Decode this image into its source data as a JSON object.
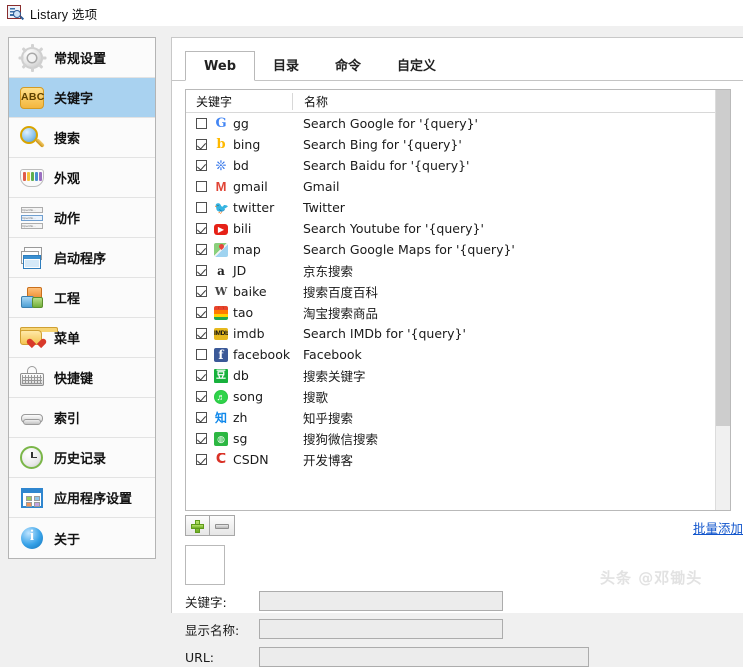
{
  "window": {
    "title": "Listary 选项",
    "icon": "listary-app-icon"
  },
  "sidebar": {
    "items": [
      {
        "label": "常规设置",
        "icon": "gear-icon",
        "selected": false
      },
      {
        "label": "关键字",
        "icon": "abc-icon",
        "selected": true
      },
      {
        "label": "搜索",
        "icon": "magnifier-icon",
        "selected": false
      },
      {
        "label": "外观",
        "icon": "color-fan-icon",
        "selected": false
      },
      {
        "label": "动作",
        "icon": "actions-list-icon",
        "selected": false
      },
      {
        "label": "启动程序",
        "icon": "windows-stack-icon",
        "selected": false
      },
      {
        "label": "工程",
        "icon": "boxes-icon",
        "selected": false
      },
      {
        "label": "菜单",
        "icon": "folder-heart-icon",
        "selected": false
      },
      {
        "label": "快捷键",
        "icon": "keyboard-icon",
        "selected": false
      },
      {
        "label": "索引",
        "icon": "drive-icon",
        "selected": false
      },
      {
        "label": "历史记录",
        "icon": "clock-history-icon",
        "selected": false
      },
      {
        "label": "应用程序设置",
        "icon": "app-settings-icon",
        "selected": false
      },
      {
        "label": "关于",
        "icon": "info-icon",
        "selected": false
      }
    ]
  },
  "main": {
    "tabs": [
      {
        "label": "Web",
        "active": true
      },
      {
        "label": "目录",
        "active": false
      },
      {
        "label": "命令",
        "active": false
      },
      {
        "label": "自定义",
        "active": false
      }
    ],
    "table": {
      "columns": [
        "关键字",
        "名称"
      ],
      "rows": [
        {
          "checked": false,
          "icon": "google-favicon",
          "icon_glyph": "G",
          "icon_class": "f-google",
          "keyword": "gg",
          "name": "Search Google for '{query}'"
        },
        {
          "checked": true,
          "icon": "bing-favicon",
          "icon_glyph": "b",
          "icon_class": "f-bing",
          "keyword": "bing",
          "name": "Search Bing for '{query}'"
        },
        {
          "checked": true,
          "icon": "baidu-favicon",
          "icon_glyph": "❊",
          "icon_class": "f-baidu",
          "keyword": "bd",
          "name": "Search Baidu for '{query}'"
        },
        {
          "checked": false,
          "icon": "gmail-favicon",
          "icon_glyph": "M",
          "icon_class": "f-gmail",
          "keyword": "gmail",
          "name": "Gmail"
        },
        {
          "checked": false,
          "icon": "twitter-favicon",
          "icon_glyph": "🐦",
          "icon_class": "f-twitter",
          "keyword": "twitter",
          "name": "Twitter"
        },
        {
          "checked": true,
          "icon": "youtube-favicon",
          "icon_glyph": "▶",
          "icon_class": "f-yt",
          "keyword": "bili",
          "name": "Search Youtube for '{query}'"
        },
        {
          "checked": true,
          "icon": "google-maps-favicon",
          "icon_glyph": "",
          "icon_class": "f-map",
          "keyword": "map",
          "name": "Search Google Maps for '{query}'"
        },
        {
          "checked": true,
          "icon": "amazon-favicon",
          "icon_glyph": "a",
          "icon_class": "f-amz",
          "keyword": "JD",
          "name": "京东搜索"
        },
        {
          "checked": true,
          "icon": "wikipedia-favicon",
          "icon_glyph": "W",
          "icon_class": "f-wiki",
          "keyword": "baike",
          "name": "搜索百度百科"
        },
        {
          "checked": true,
          "icon": "taobao-favicon",
          "icon_glyph": "",
          "icon_class": "f-tao",
          "keyword": "tao",
          "name": "淘宝搜索商品"
        },
        {
          "checked": true,
          "icon": "imdb-favicon",
          "icon_glyph": "IMDb",
          "icon_class": "f-imdb",
          "keyword": "imdb",
          "name": "Search IMDb for '{query}'"
        },
        {
          "checked": false,
          "icon": "facebook-favicon",
          "icon_glyph": "f",
          "icon_class": "f-fb",
          "keyword": "facebook",
          "name": "Facebook"
        },
        {
          "checked": true,
          "icon": "douban-favicon",
          "icon_glyph": "豆",
          "icon_class": "f-db",
          "keyword": "db",
          "name": "搜索关键字"
        },
        {
          "checked": true,
          "icon": "music-favicon",
          "icon_glyph": "♬",
          "icon_class": "f-song",
          "keyword": "song",
          "name": "搜歌"
        },
        {
          "checked": true,
          "icon": "zhihu-favicon",
          "icon_glyph": "知",
          "icon_class": "f-zh",
          "keyword": "zh",
          "name": "知乎搜索"
        },
        {
          "checked": true,
          "icon": "sogou-favicon",
          "icon_glyph": "◍",
          "icon_class": "f-sg",
          "keyword": "sg",
          "name": "搜狗微信搜索"
        },
        {
          "checked": true,
          "icon": "csdn-favicon",
          "icon_glyph": "C",
          "icon_class": "f-csdn",
          "keyword": "CSDN",
          "name": "开发博客"
        }
      ]
    },
    "toolbar": {
      "add_label": "添加",
      "remove_label": "删除",
      "bulk_add_label": "批量添加"
    },
    "form": {
      "keyword_label": "关键字:",
      "keyword_value": "",
      "display_name_label": "显示名称:",
      "display_name_value": "",
      "url_label": "URL:",
      "url_value": ""
    }
  },
  "watermark": {
    "text": "头条 @邓锄头"
  },
  "colors": {
    "selection": "#a9d2f0",
    "link": "#1155cc",
    "window_bg": "#f0f0f0"
  }
}
